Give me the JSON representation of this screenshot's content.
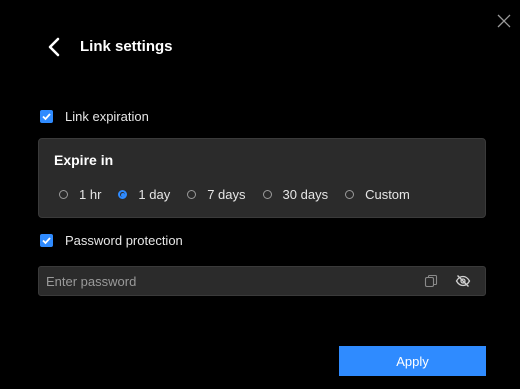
{
  "dialog": {
    "title": "Link settings",
    "back_icon": "chevron-left-icon",
    "close_icon": "close-icon"
  },
  "link_expiration": {
    "label": "Link expiration",
    "checked": true
  },
  "expire": {
    "title": "Expire in",
    "options": [
      {
        "label": "1 hr",
        "selected": false
      },
      {
        "label": "1 day",
        "selected": true
      },
      {
        "label": "7 days",
        "selected": false
      },
      {
        "label": "30 days",
        "selected": false
      },
      {
        "label": "Custom",
        "selected": false
      }
    ]
  },
  "password": {
    "label": "Password protection",
    "checked": true,
    "placeholder": "Enter password",
    "value": "",
    "copy_icon": "copy-icon",
    "visibility_icon": "eye-off-icon"
  },
  "apply_label": "Apply",
  "colors": {
    "accent": "#2f8bff",
    "background": "#000000",
    "panel": "#2b2b2b"
  }
}
